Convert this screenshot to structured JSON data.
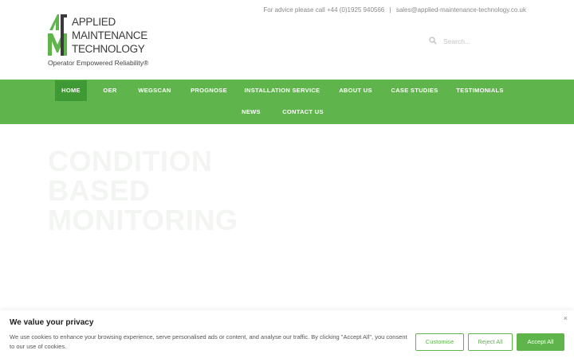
{
  "header": {
    "logo_lines": [
      "APPLIED",
      "MAINTENANCE",
      "TECHNOLOGY"
    ],
    "tagline": "Operator Empowered Reliability®",
    "contact_prefix": "For advice please call",
    "phone": "+44 (0)1925 940566",
    "separator": "|",
    "email": "sales@applied-maintenance-technology.co.uk",
    "search_placeholder": "Search..."
  },
  "nav": {
    "items": [
      {
        "label": "HOME"
      },
      {
        "label": "OER"
      },
      {
        "label": "WEGSCAN"
      },
      {
        "label": "PROGNOSE"
      },
      {
        "label": "INSTALLATION SERVICE"
      },
      {
        "label": "ABOUT US"
      },
      {
        "label": "CASE STUDIES"
      },
      {
        "label": "TESTIMONIALS"
      },
      {
        "label": "NEWS"
      },
      {
        "label": "CONTACT US"
      }
    ],
    "active": "HOME"
  },
  "hero": {
    "title_lines": [
      "CONDITION",
      "BASED",
      "MONITORING"
    ]
  },
  "cookie": {
    "title": "We value your privacy",
    "text": "We use cookies to enhance your browsing experience, serve personalised ads or content, and analyse our traffic. By clicking \"Accept All\", you consent to our use of cookies.",
    "close": "×",
    "customise_label": "Customise",
    "reject_label": "Reject All",
    "accept_label": "Accept All"
  },
  "colors": {
    "brand_green": "#5fb54c",
    "nav_active": "#3f9a35"
  }
}
